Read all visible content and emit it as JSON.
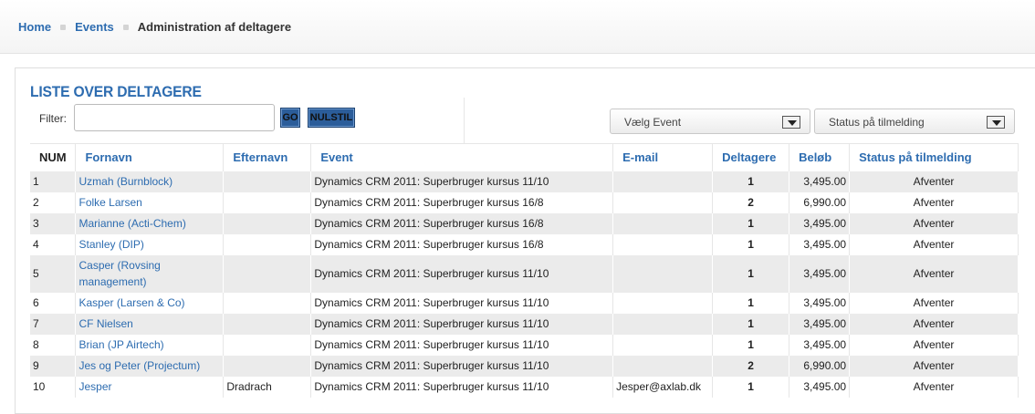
{
  "breadcrumb": {
    "home": "Home",
    "events": "Events",
    "current": "Administration af deltagere"
  },
  "title": "LISTE OVER DELTAGERE",
  "filter": {
    "label": "Filter:",
    "value": "",
    "go_label": "GO",
    "reset_label": "NULSTIL"
  },
  "selects": {
    "event": "Vælg Event",
    "status": "Status på tilmelding"
  },
  "table": {
    "headers": [
      "NUM",
      "Fornavn",
      "Efternavn",
      "Event",
      "E-mail",
      "Deltagere",
      "Beløb",
      "Status på tilmelding"
    ],
    "rows": [
      [
        "1",
        "Uzmah (Burnblock)",
        "",
        "Dynamics CRM 2011: Superbruger kursus 11/10",
        "",
        "1",
        "3,495.00",
        "Afventer"
      ],
      [
        "2",
        "Folke Larsen",
        "",
        "Dynamics CRM 2011: Superbruger kursus 16/8",
        "",
        "2",
        "6,990.00",
        "Afventer"
      ],
      [
        "3",
        "Marianne (Acti-Chem)",
        "",
        "Dynamics CRM 2011: Superbruger kursus 16/8",
        "",
        "1",
        "3,495.00",
        "Afventer"
      ],
      [
        "4",
        "Stanley (DIP)",
        "",
        "Dynamics CRM 2011: Superbruger kursus 16/8",
        "",
        "1",
        "3,495.00",
        "Afventer"
      ],
      [
        "5",
        "Casper (Rovsing management)",
        "",
        "Dynamics CRM 2011: Superbruger kursus 11/10",
        "",
        "1",
        "3,495.00",
        "Afventer"
      ],
      [
        "6",
        "Kasper (Larsen & Co)",
        "",
        "Dynamics CRM 2011: Superbruger kursus 11/10",
        "",
        "1",
        "3,495.00",
        "Afventer"
      ],
      [
        "7",
        "CF Nielsen",
        "",
        "Dynamics CRM 2011: Superbruger kursus 11/10",
        "",
        "1",
        "3,495.00",
        "Afventer"
      ],
      [
        "8",
        "Brian (JP Airtech)",
        "",
        "Dynamics CRM 2011: Superbruger kursus 11/10",
        "",
        "1",
        "3,495.00",
        "Afventer"
      ],
      [
        "9",
        "Jes og Peter (Projectum)",
        "",
        "Dynamics CRM 2011: Superbruger kursus 11/10",
        "",
        "2",
        "6,990.00",
        "Afventer"
      ],
      [
        "10",
        "Jesper",
        "Dradrach",
        "Dynamics CRM 2011: Superbruger kursus 11/10",
        "Jesper@axlab.dk",
        "1",
        "3,495.00",
        "Afventer"
      ]
    ]
  },
  "colors": {
    "link": "#2d6cb0",
    "button": "#2b5d9a",
    "row_alt": "#ebebeb"
  }
}
